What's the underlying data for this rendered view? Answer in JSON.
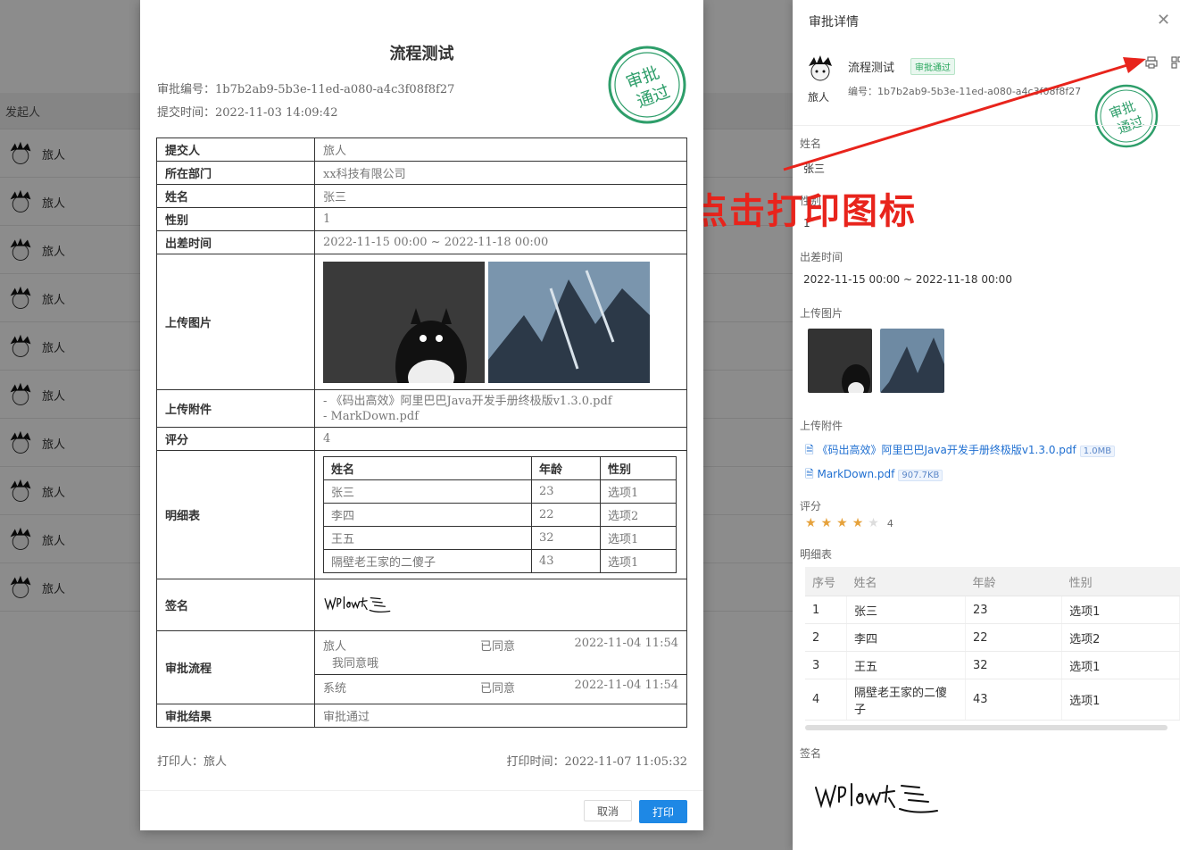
{
  "background": {
    "column_header": "发起人",
    "rows": [
      "旅人",
      "旅人",
      "旅人",
      "旅人",
      "旅人",
      "旅人",
      "旅人",
      "旅人",
      "旅人",
      "旅人"
    ]
  },
  "drawer": {
    "title": "审批详情",
    "flow_name": "流程测试",
    "status_tag": "审批通过",
    "number_label": "编号：1b7b2ab9-5b3e-11ed-a080-a4c3f08f8f27",
    "user_name": "旅人",
    "fields": {
      "name_label": "姓名",
      "name_value": "张三",
      "gender_label": "性别",
      "gender_value": "1",
      "trip_label": "出差时间",
      "trip_value": "2022-11-15 00:00 ~ 2022-11-18 00:00",
      "images_label": "上传图片",
      "files_label": "上传附件",
      "rating_label": "评分",
      "rating_value": "4",
      "detail_label": "明细表",
      "sign_label": "签名"
    },
    "files": [
      {
        "name": "《码出高效》阿里巴巴Java开发手册终极版v1.3.0.pdf",
        "size": "1.0MB"
      },
      {
        "name": "MarkDown.pdf",
        "size": "907.7KB"
      }
    ],
    "rating": 4,
    "detail_headers": [
      "序号",
      "姓名",
      "年龄",
      "性别"
    ],
    "detail_rows": [
      [
        "1",
        "张三",
        "23",
        "选项1"
      ],
      [
        "2",
        "李四",
        "22",
        "选项2"
      ],
      [
        "3",
        "王五",
        "32",
        "选项1"
      ],
      [
        "4",
        "隔壁老王家的二傻子",
        "43",
        "选项1"
      ]
    ]
  },
  "annotation": {
    "text": "点击打印图标"
  },
  "print": {
    "title": "流程测试",
    "approval_no": "审批编号：1b7b2ab9-5b3e-11ed-a080-a4c3f08f8f27",
    "submit_time": "提交时间：2022-11-03 14:09:42",
    "stamp_text_1": "审批",
    "stamp_text_2": "通过",
    "rows": {
      "submitter_label": "提交人",
      "submitter_value": "旅人",
      "dept_label": "所在部门",
      "dept_value": "xx科技有限公司",
      "name_label": "姓名",
      "name_value": "张三",
      "gender_label": "性别",
      "gender_value": "1",
      "trip_label": "出差时间",
      "trip_value": "2022-11-15 00:00 ~ 2022-11-18 00:00",
      "images_label": "上传图片",
      "files_label": "上传附件",
      "file_1": "- 《码出高效》阿里巴巴Java开发手册终极版v1.3.0.pdf",
      "file_2": "- MarkDown.pdf",
      "rating_label": "评分",
      "rating_value": "4",
      "detail_label": "明细表",
      "sign_label": "签名",
      "process_label": "审批流程",
      "result_label": "审批结果",
      "result_value": "审批通过"
    },
    "detail_headers": [
      "姓名",
      "年龄",
      "性别"
    ],
    "detail_rows": [
      [
        "张三",
        "23",
        "选项1"
      ],
      [
        "李四",
        "22",
        "选项2"
      ],
      [
        "王五",
        "32",
        "选项1"
      ],
      [
        "隔壁老王家的二傻子",
        "43",
        "选项1"
      ]
    ],
    "process": [
      {
        "user": "旅人",
        "status": "已同意",
        "time": "2022-11-04 11:54",
        "comment": "我同意哦"
      },
      {
        "user": "系统",
        "status": "已同意",
        "time": "2022-11-04 11:54",
        "comment": ""
      }
    ],
    "printer": "打印人：旅人",
    "print_time": "打印时间：2022-11-07 11:05:32",
    "cancel_label": "取消",
    "print_label": "打印"
  },
  "colors": {
    "accent": "#1e88e5",
    "stamp": "#2e9e6a",
    "annotation": "#e8241c"
  }
}
